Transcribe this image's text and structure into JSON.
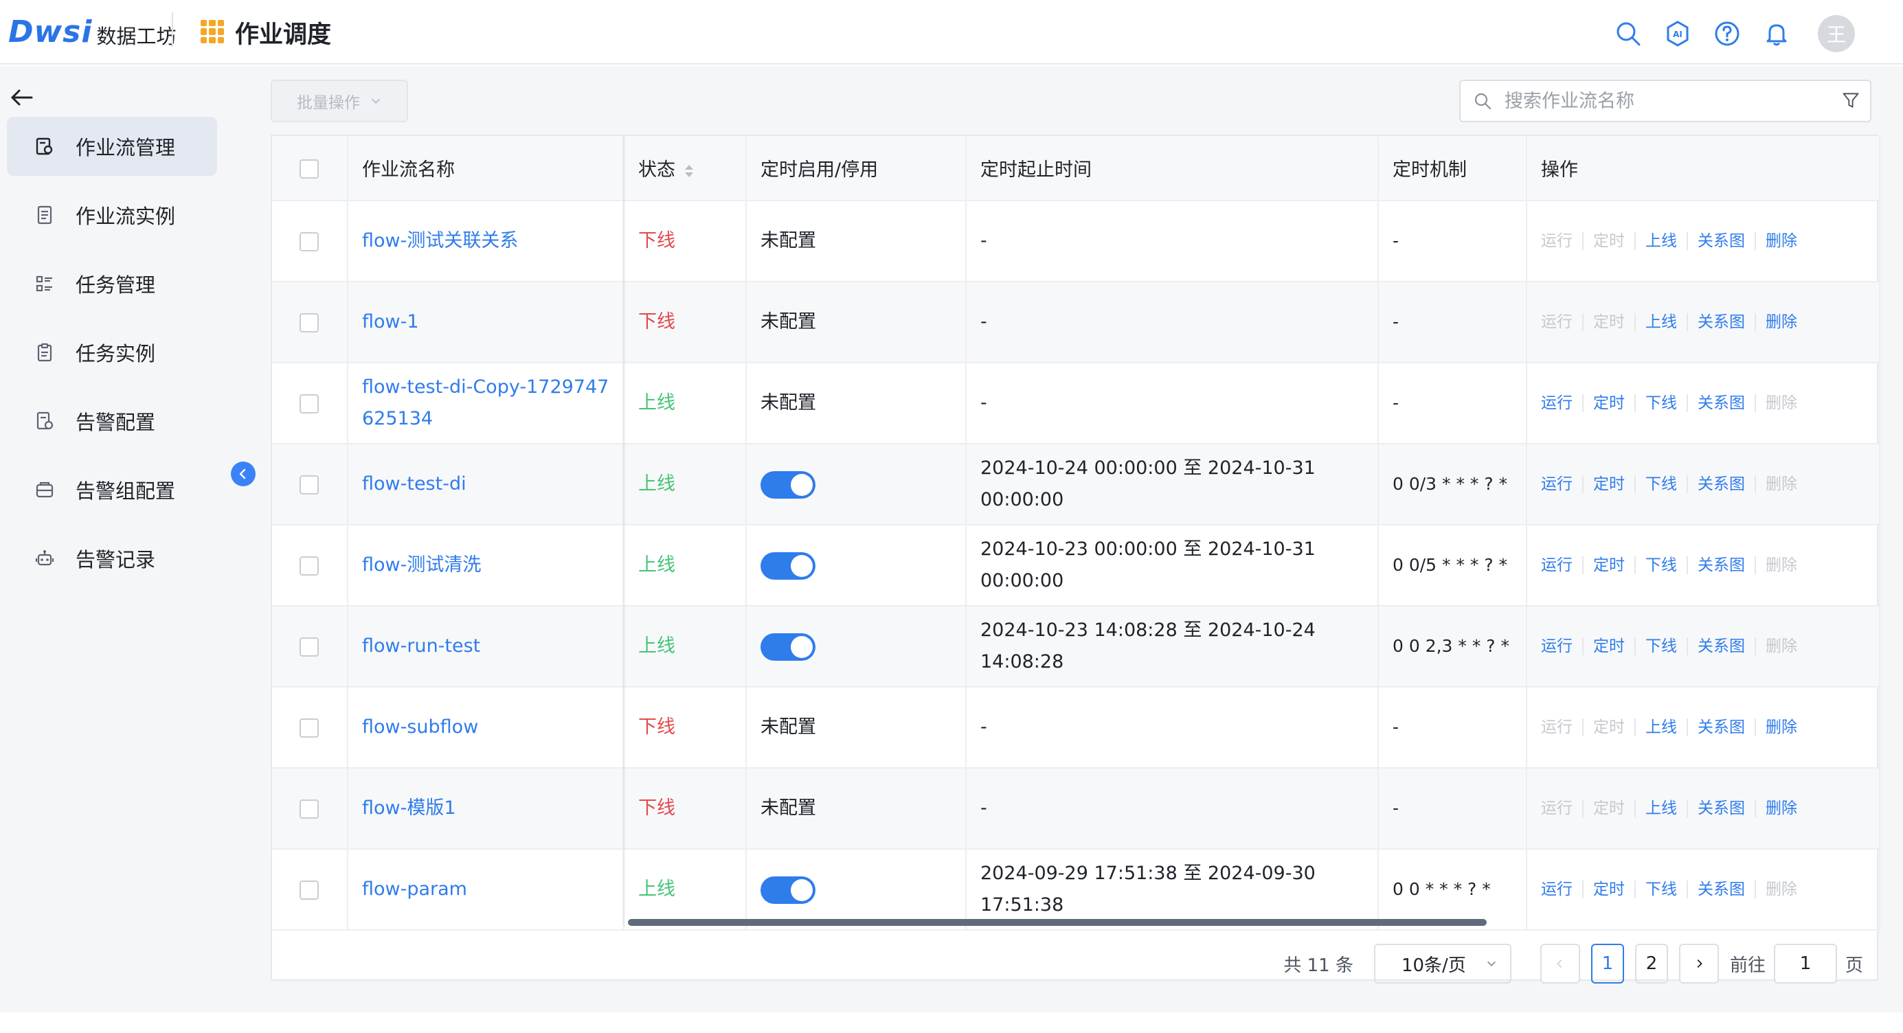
{
  "header": {
    "logo_mark": "Dwsi",
    "logo_text": "数据工坊",
    "app_title": "作业调度",
    "avatar_text": "王"
  },
  "icons": {
    "search": "search-icon",
    "ai": "ai-assistant-icon",
    "help": "help-icon",
    "bell": "bell-icon"
  },
  "sidebar": {
    "items": [
      {
        "label": "作业流管理",
        "icon": "workflow-icon",
        "active": true
      },
      {
        "label": "作业流实例",
        "icon": "document-list-icon",
        "active": false
      },
      {
        "label": "任务管理",
        "icon": "task-list-icon",
        "active": false
      },
      {
        "label": "任务实例",
        "icon": "clipboard-icon",
        "active": false
      },
      {
        "label": "告警配置",
        "icon": "alert-config-icon",
        "active": false
      },
      {
        "label": "告警组配置",
        "icon": "alert-group-icon",
        "active": false
      },
      {
        "label": "告警记录",
        "icon": "robot-icon",
        "active": false
      }
    ]
  },
  "toolbar": {
    "batch_label": "批量操作",
    "search_placeholder": "搜索作业流名称"
  },
  "table": {
    "columns": [
      "作业流名称",
      "状态",
      "定时启用/停用",
      "定时起止时间",
      "定时机制",
      "操作"
    ],
    "rows": [
      {
        "name": "flow-测试关联关系",
        "status": "下线",
        "online": false,
        "schedule_enabled": null,
        "schedule_text": "未配置",
        "time_range": "-",
        "cron": "-",
        "ops": [
          "运行",
          "定时",
          "上线",
          "关系图",
          "删除"
        ]
      },
      {
        "name": "flow-1",
        "status": "下线",
        "online": false,
        "schedule_enabled": null,
        "schedule_text": "未配置",
        "time_range": "-",
        "cron": "-",
        "ops": [
          "运行",
          "定时",
          "上线",
          "关系图",
          "删除"
        ]
      },
      {
        "name": "flow-test-di-Copy-1729747625134",
        "status": "上线",
        "online": true,
        "schedule_enabled": null,
        "schedule_text": "未配置",
        "time_range": "-",
        "cron": "-",
        "ops": [
          "运行",
          "定时",
          "下线",
          "关系图",
          "删除"
        ]
      },
      {
        "name": "flow-test-di",
        "status": "上线",
        "online": true,
        "schedule_enabled": true,
        "schedule_text": "",
        "time_range": "2024-10-24 00:00:00 至 2024-10-31 00:00:00",
        "cron": "0 0/3 * * * ? *",
        "ops": [
          "运行",
          "定时",
          "下线",
          "关系图",
          "删除"
        ]
      },
      {
        "name": "flow-测试清洗",
        "status": "上线",
        "online": true,
        "schedule_enabled": true,
        "schedule_text": "",
        "time_range": "2024-10-23 00:00:00 至 2024-10-31 00:00:00",
        "cron": "0 0/5 * * * ? *",
        "ops": [
          "运行",
          "定时",
          "下线",
          "关系图",
          "删除"
        ]
      },
      {
        "name": "flow-run-test",
        "status": "上线",
        "online": true,
        "schedule_enabled": true,
        "schedule_text": "",
        "time_range": "2024-10-23 14:08:28 至 2024-10-24 14:08:28",
        "cron": "0 0 2,3 * * ? *",
        "ops": [
          "运行",
          "定时",
          "下线",
          "关系图",
          "删除"
        ]
      },
      {
        "name": "flow-subflow",
        "status": "下线",
        "online": false,
        "schedule_enabled": null,
        "schedule_text": "未配置",
        "time_range": "-",
        "cron": "-",
        "ops": [
          "运行",
          "定时",
          "上线",
          "关系图",
          "删除"
        ]
      },
      {
        "name": "flow-模版1",
        "status": "下线",
        "online": false,
        "schedule_enabled": null,
        "schedule_text": "未配置",
        "time_range": "-",
        "cron": "-",
        "ops": [
          "运行",
          "定时",
          "上线",
          "关系图",
          "删除"
        ]
      },
      {
        "name": "flow-param",
        "status": "上线",
        "online": true,
        "schedule_enabled": true,
        "schedule_text": "",
        "time_range": "2024-09-29 17:51:38 至 2024-09-30 17:51:38",
        "cron": "0 0 * * * ? *",
        "ops": [
          "运行",
          "定时",
          "下线",
          "关系图",
          "删除"
        ]
      }
    ]
  },
  "pagination": {
    "total_text": "共 11 条",
    "page_size": "10条/页",
    "pages": [
      "1",
      "2"
    ],
    "current": "1",
    "goto_label": "前往",
    "goto_value": "1",
    "page_suffix": "页"
  },
  "colors": {
    "primary": "#2f7ceb",
    "offline": "#e5484d",
    "online": "#45c476",
    "disabled": "#c5c8ce",
    "logo": "#2b74e8",
    "app_grid": "#f5a623"
  }
}
